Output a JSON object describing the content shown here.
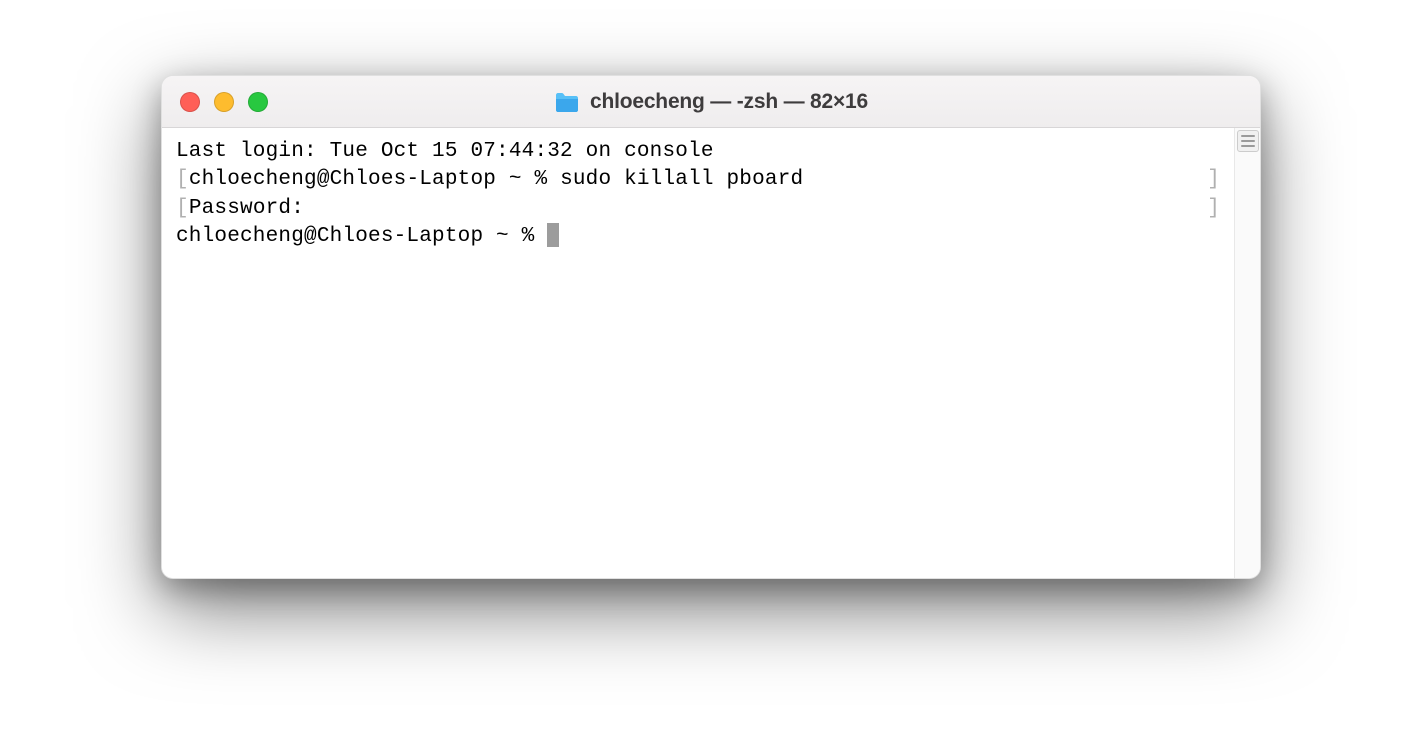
{
  "window": {
    "title": "chloecheng — -zsh — 82×16"
  },
  "terminal": {
    "lines": [
      {
        "prefix": "",
        "content": "Last login: Tue Oct 15 07:44:32 on console",
        "suffix": ""
      },
      {
        "prefix": "[",
        "content": "chloecheng@Chloes-Laptop ~ % sudo killall pboard",
        "suffix": "]"
      },
      {
        "prefix": "[",
        "content": "Password:",
        "suffix": "]"
      },
      {
        "prefix": "",
        "content": "chloecheng@Chloes-Laptop ~ % ",
        "suffix": "",
        "cursor": true
      }
    ]
  }
}
